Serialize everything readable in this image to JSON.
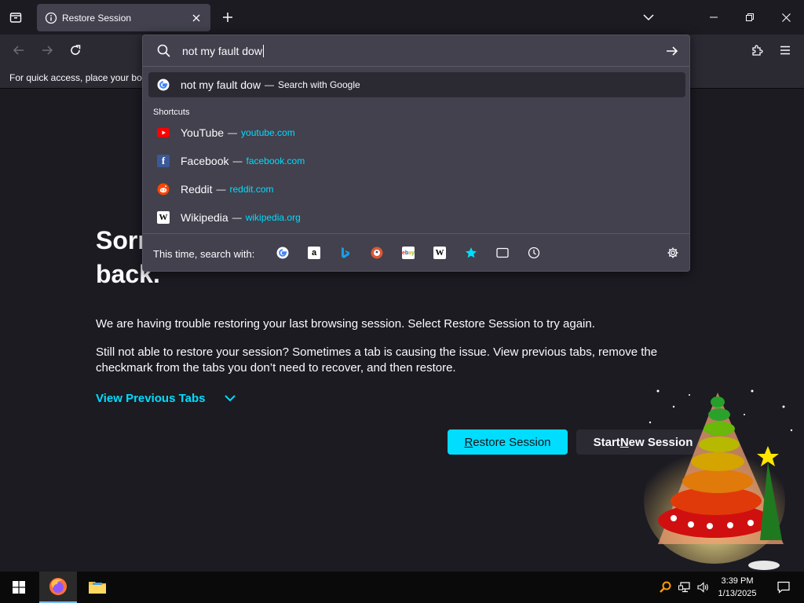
{
  "window": {
    "tab_title": "Restore Session"
  },
  "bookmarks_bar": {
    "hint": "For quick access, place your boo"
  },
  "urlbar": {
    "typed_text": "not my fault dow",
    "suggestion": {
      "query": "not my fault dow",
      "separator": "—",
      "action": "Search with Google"
    },
    "shortcuts_label": "Shortcuts",
    "shortcuts": [
      {
        "title": "YouTube",
        "url": "youtube.com",
        "icon": "youtube-icon"
      },
      {
        "title": "Facebook",
        "url": "facebook.com",
        "icon": "facebook-icon"
      },
      {
        "title": "Reddit",
        "url": "reddit.com",
        "icon": "reddit-icon"
      },
      {
        "title": "Wikipedia",
        "url": "wikipedia.org",
        "icon": "wikipedia-icon"
      }
    ],
    "search_with_label": "This time, search with:",
    "engines": [
      "google-icon",
      "amazon-icon",
      "bing-icon",
      "duckduckgo-icon",
      "ebay-icon",
      "wikipedia-icon",
      "bookmarks-star-icon",
      "tabs-icon",
      "history-icon"
    ]
  },
  "page": {
    "heading_line1": "Sorr",
    "heading_line2": "back.",
    "para1": "We are having trouble restoring your last browsing session. Select Restore Session to try again.",
    "para2": "Still not able to restore your session? Sometimes a tab is causing the issue. View previous tabs, remove the checkmark from the tabs you don’t need to recover, and then restore.",
    "view_previous": "View Previous Tabs",
    "restore_btn": {
      "pre": "",
      "ul": "R",
      "post": "estore Session"
    },
    "new_session_btn": {
      "pre": "Start ",
      "ul": "N",
      "post": "ew Session"
    }
  },
  "taskbar": {
    "time": "3:39 PM",
    "date": "1/13/2025"
  },
  "colors": {
    "accent": "#00ddff",
    "toolbar": "#2b2a33",
    "content_bg": "#1c1b22",
    "popup_bg": "#42414d"
  }
}
